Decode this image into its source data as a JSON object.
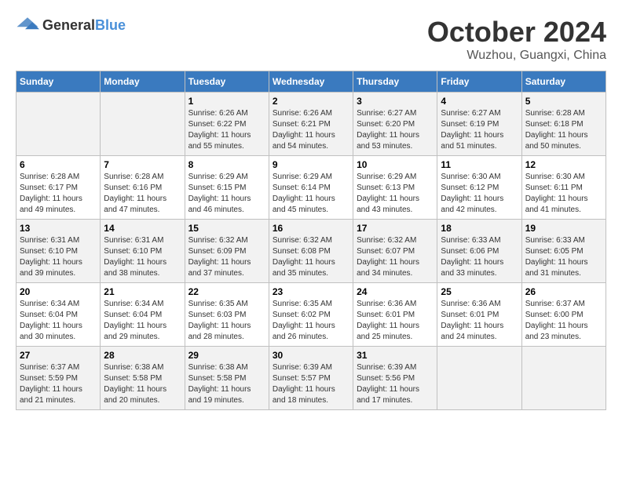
{
  "header": {
    "logo": {
      "general": "General",
      "blue": "Blue"
    },
    "month": "October 2024",
    "location": "Wuzhou, Guangxi, China"
  },
  "weekdays": [
    "Sunday",
    "Monday",
    "Tuesday",
    "Wednesday",
    "Thursday",
    "Friday",
    "Saturday"
  ],
  "weeks": [
    [
      {
        "day": "",
        "sunrise": "",
        "sunset": "",
        "daylight": ""
      },
      {
        "day": "",
        "sunrise": "",
        "sunset": "",
        "daylight": ""
      },
      {
        "day": "1",
        "sunrise": "Sunrise: 6:26 AM",
        "sunset": "Sunset: 6:22 PM",
        "daylight": "Daylight: 11 hours and 55 minutes."
      },
      {
        "day": "2",
        "sunrise": "Sunrise: 6:26 AM",
        "sunset": "Sunset: 6:21 PM",
        "daylight": "Daylight: 11 hours and 54 minutes."
      },
      {
        "day": "3",
        "sunrise": "Sunrise: 6:27 AM",
        "sunset": "Sunset: 6:20 PM",
        "daylight": "Daylight: 11 hours and 53 minutes."
      },
      {
        "day": "4",
        "sunrise": "Sunrise: 6:27 AM",
        "sunset": "Sunset: 6:19 PM",
        "daylight": "Daylight: 11 hours and 51 minutes."
      },
      {
        "day": "5",
        "sunrise": "Sunrise: 6:28 AM",
        "sunset": "Sunset: 6:18 PM",
        "daylight": "Daylight: 11 hours and 50 minutes."
      }
    ],
    [
      {
        "day": "6",
        "sunrise": "Sunrise: 6:28 AM",
        "sunset": "Sunset: 6:17 PM",
        "daylight": "Daylight: 11 hours and 49 minutes."
      },
      {
        "day": "7",
        "sunrise": "Sunrise: 6:28 AM",
        "sunset": "Sunset: 6:16 PM",
        "daylight": "Daylight: 11 hours and 47 minutes."
      },
      {
        "day": "8",
        "sunrise": "Sunrise: 6:29 AM",
        "sunset": "Sunset: 6:15 PM",
        "daylight": "Daylight: 11 hours and 46 minutes."
      },
      {
        "day": "9",
        "sunrise": "Sunrise: 6:29 AM",
        "sunset": "Sunset: 6:14 PM",
        "daylight": "Daylight: 11 hours and 45 minutes."
      },
      {
        "day": "10",
        "sunrise": "Sunrise: 6:29 AM",
        "sunset": "Sunset: 6:13 PM",
        "daylight": "Daylight: 11 hours and 43 minutes."
      },
      {
        "day": "11",
        "sunrise": "Sunrise: 6:30 AM",
        "sunset": "Sunset: 6:12 PM",
        "daylight": "Daylight: 11 hours and 42 minutes."
      },
      {
        "day": "12",
        "sunrise": "Sunrise: 6:30 AM",
        "sunset": "Sunset: 6:11 PM",
        "daylight": "Daylight: 11 hours and 41 minutes."
      }
    ],
    [
      {
        "day": "13",
        "sunrise": "Sunrise: 6:31 AM",
        "sunset": "Sunset: 6:10 PM",
        "daylight": "Daylight: 11 hours and 39 minutes."
      },
      {
        "day": "14",
        "sunrise": "Sunrise: 6:31 AM",
        "sunset": "Sunset: 6:10 PM",
        "daylight": "Daylight: 11 hours and 38 minutes."
      },
      {
        "day": "15",
        "sunrise": "Sunrise: 6:32 AM",
        "sunset": "Sunset: 6:09 PM",
        "daylight": "Daylight: 11 hours and 37 minutes."
      },
      {
        "day": "16",
        "sunrise": "Sunrise: 6:32 AM",
        "sunset": "Sunset: 6:08 PM",
        "daylight": "Daylight: 11 hours and 35 minutes."
      },
      {
        "day": "17",
        "sunrise": "Sunrise: 6:32 AM",
        "sunset": "Sunset: 6:07 PM",
        "daylight": "Daylight: 11 hours and 34 minutes."
      },
      {
        "day": "18",
        "sunrise": "Sunrise: 6:33 AM",
        "sunset": "Sunset: 6:06 PM",
        "daylight": "Daylight: 11 hours and 33 minutes."
      },
      {
        "day": "19",
        "sunrise": "Sunrise: 6:33 AM",
        "sunset": "Sunset: 6:05 PM",
        "daylight": "Daylight: 11 hours and 31 minutes."
      }
    ],
    [
      {
        "day": "20",
        "sunrise": "Sunrise: 6:34 AM",
        "sunset": "Sunset: 6:04 PM",
        "daylight": "Daylight: 11 hours and 30 minutes."
      },
      {
        "day": "21",
        "sunrise": "Sunrise: 6:34 AM",
        "sunset": "Sunset: 6:04 PM",
        "daylight": "Daylight: 11 hours and 29 minutes."
      },
      {
        "day": "22",
        "sunrise": "Sunrise: 6:35 AM",
        "sunset": "Sunset: 6:03 PM",
        "daylight": "Daylight: 11 hours and 28 minutes."
      },
      {
        "day": "23",
        "sunrise": "Sunrise: 6:35 AM",
        "sunset": "Sunset: 6:02 PM",
        "daylight": "Daylight: 11 hours and 26 minutes."
      },
      {
        "day": "24",
        "sunrise": "Sunrise: 6:36 AM",
        "sunset": "Sunset: 6:01 PM",
        "daylight": "Daylight: 11 hours and 25 minutes."
      },
      {
        "day": "25",
        "sunrise": "Sunrise: 6:36 AM",
        "sunset": "Sunset: 6:01 PM",
        "daylight": "Daylight: 11 hours and 24 minutes."
      },
      {
        "day": "26",
        "sunrise": "Sunrise: 6:37 AM",
        "sunset": "Sunset: 6:00 PM",
        "daylight": "Daylight: 11 hours and 23 minutes."
      }
    ],
    [
      {
        "day": "27",
        "sunrise": "Sunrise: 6:37 AM",
        "sunset": "Sunset: 5:59 PM",
        "daylight": "Daylight: 11 hours and 21 minutes."
      },
      {
        "day": "28",
        "sunrise": "Sunrise: 6:38 AM",
        "sunset": "Sunset: 5:58 PM",
        "daylight": "Daylight: 11 hours and 20 minutes."
      },
      {
        "day": "29",
        "sunrise": "Sunrise: 6:38 AM",
        "sunset": "Sunset: 5:58 PM",
        "daylight": "Daylight: 11 hours and 19 minutes."
      },
      {
        "day": "30",
        "sunrise": "Sunrise: 6:39 AM",
        "sunset": "Sunset: 5:57 PM",
        "daylight": "Daylight: 11 hours and 18 minutes."
      },
      {
        "day": "31",
        "sunrise": "Sunrise: 6:39 AM",
        "sunset": "Sunset: 5:56 PM",
        "daylight": "Daylight: 11 hours and 17 minutes."
      },
      {
        "day": "",
        "sunrise": "",
        "sunset": "",
        "daylight": ""
      },
      {
        "day": "",
        "sunrise": "",
        "sunset": "",
        "daylight": ""
      }
    ]
  ]
}
